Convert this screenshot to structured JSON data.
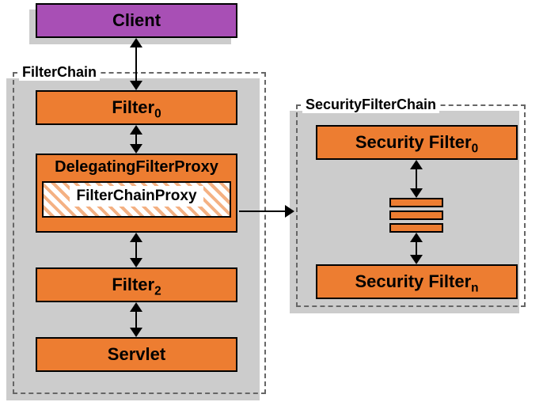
{
  "client": {
    "label": "Client"
  },
  "filterChain": {
    "label": "FilterChain",
    "filter0": {
      "label": "Filter",
      "sub": "0"
    },
    "delegating": {
      "label": "DelegatingFilterProxy"
    },
    "fcProxy": {
      "label": "FilterChainProxy"
    },
    "filter2": {
      "label": "Filter",
      "sub": "2"
    },
    "servlet": {
      "label": "Servlet"
    }
  },
  "securityFilterChain": {
    "label": "SecurityFilterChain",
    "sf0": {
      "label": "Security Filter",
      "sub": "0"
    },
    "sfn": {
      "label": "Security Filter",
      "sub": "n"
    }
  }
}
